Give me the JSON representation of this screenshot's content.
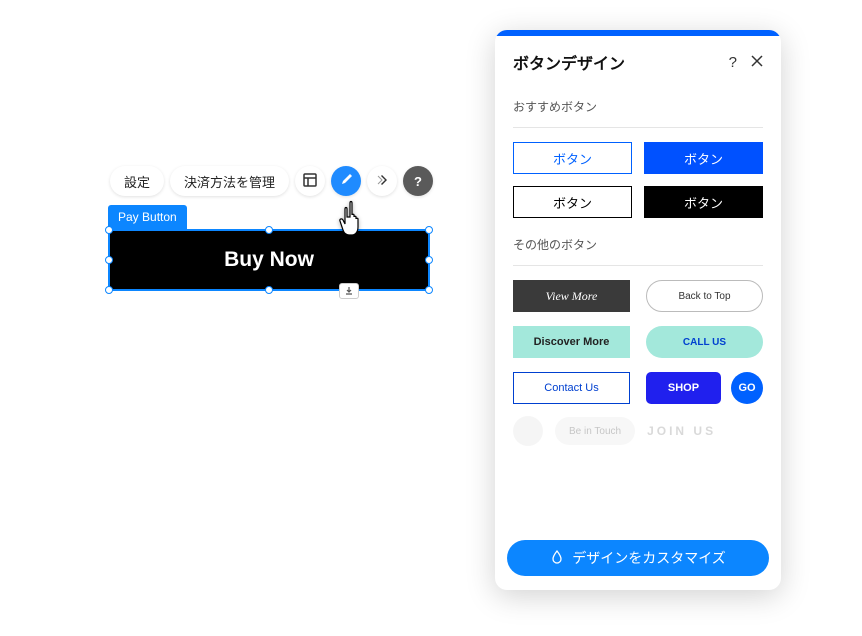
{
  "toolbar": {
    "settings_label": "設定",
    "manage_payment_label": "決済方法を管理"
  },
  "selected": {
    "tag": "Pay Button",
    "button_text": "Buy Now"
  },
  "panel": {
    "title": "ボタンデザイン",
    "recommended_label": "おすすめボタン",
    "other_label": "その他のボタン",
    "presets": {
      "p1": "ボタン",
      "p2": "ボタン",
      "p3": "ボタン",
      "p4": "ボタン"
    },
    "others": {
      "o1": "View More",
      "o2": "Back to Top",
      "o3": "Discover More",
      "o4": "CALL US",
      "o5": "Contact Us",
      "o6": "SHOP",
      "go": "GO",
      "pill": "Be in Touch",
      "join": "JOIN US"
    },
    "customize_label": "デザインをカスタマイズ"
  }
}
